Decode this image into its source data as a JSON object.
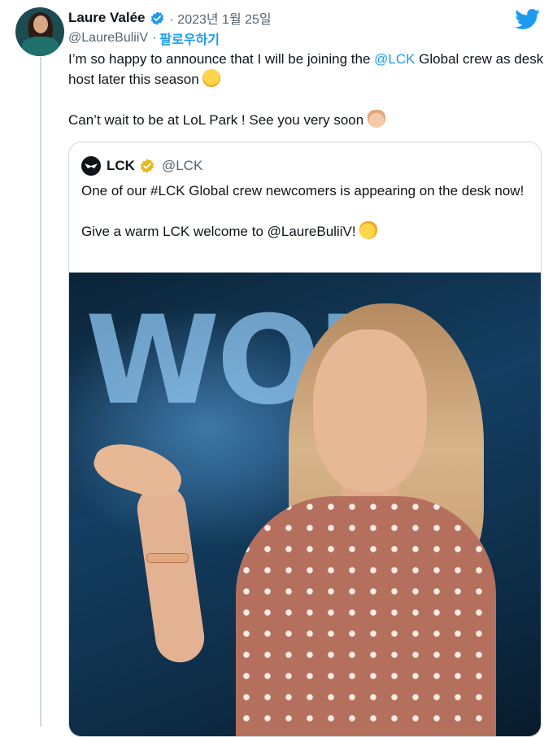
{
  "author": {
    "name": "Laure Valée",
    "handle": "@LaureBuliiV",
    "date": "· 2023년 1월 25일",
    "separator": "·",
    "follow_label": "팔로우하기"
  },
  "tweet": {
    "part1": "I’m so happy to announce that I will be joining the ",
    "mention": "@LCK",
    "part2": " Global crew as desk host later this season ",
    "line2": "Can’t wait to be at LoL Park ! See you very soon "
  },
  "quoted": {
    "name": "LCK",
    "handle": "@LCK",
    "line1": "One of our #LCK Global crew newcomers is appearing on the desk now!",
    "line2": "Give a warm LCK welcome to @LaureBuliiV! "
  },
  "photo": {
    "background_text": "WOR"
  },
  "icons": {
    "verified": "verified-badge-icon",
    "gold_verified": "gold-verified-badge-icon",
    "twitter": "twitter-bird-icon"
  },
  "colors": {
    "accent": "#1d9bf0",
    "gold": "#e2b719",
    "muted": "#536471"
  }
}
